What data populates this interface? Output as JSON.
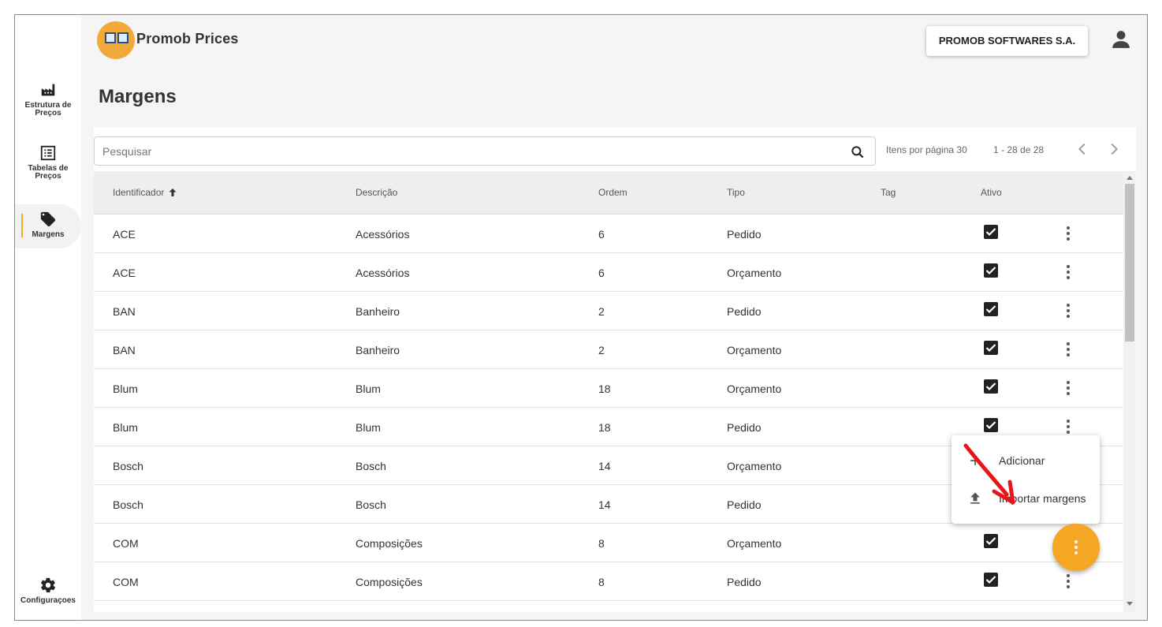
{
  "app": {
    "title": "Promob Prices",
    "company": "PROMOB SOFTWARES S.A."
  },
  "sidebar": {
    "items": [
      {
        "label": "Estrutura de Preços",
        "icon": "factory-icon"
      },
      {
        "label": "Tabelas de Preços",
        "icon": "list-icon"
      },
      {
        "label": "Margens",
        "icon": "tag-icon",
        "active": true
      }
    ],
    "settings": {
      "label": "Configuraçoes",
      "icon": "gear-icon"
    }
  },
  "page": {
    "title": "Margens"
  },
  "search": {
    "placeholder": "Pesquisar"
  },
  "pager": {
    "items_per_page": "Itens por página 30",
    "range": "1 - 28 de 28"
  },
  "table": {
    "columns": [
      "Identificador",
      "Descrição",
      "Ordem",
      "Tipo",
      "Tag",
      "Ativo"
    ],
    "rows": [
      {
        "id": "ACE",
        "desc": "Acessórios",
        "order": "6",
        "type": "Pedido",
        "tag": "",
        "active": true
      },
      {
        "id": "ACE",
        "desc": "Acessórios",
        "order": "6",
        "type": "Orçamento",
        "tag": "",
        "active": true
      },
      {
        "id": "BAN",
        "desc": "Banheiro",
        "order": "2",
        "type": "Pedido",
        "tag": "",
        "active": true
      },
      {
        "id": "BAN",
        "desc": "Banheiro",
        "order": "2",
        "type": "Orçamento",
        "tag": "",
        "active": true
      },
      {
        "id": "Blum",
        "desc": "Blum",
        "order": "18",
        "type": "Orçamento",
        "tag": "",
        "active": true
      },
      {
        "id": "Blum",
        "desc": "Blum",
        "order": "18",
        "type": "Pedido",
        "tag": "",
        "active": true
      },
      {
        "id": "Bosch",
        "desc": "Bosch",
        "order": "14",
        "type": "Orçamento",
        "tag": "",
        "active": true
      },
      {
        "id": "Bosch",
        "desc": "Bosch",
        "order": "14",
        "type": "Pedido",
        "tag": "",
        "active": true
      },
      {
        "id": "COM",
        "desc": "Composições",
        "order": "8",
        "type": "Orçamento",
        "tag": "",
        "active": true
      },
      {
        "id": "COM",
        "desc": "Composições",
        "order": "8",
        "type": "Pedido",
        "tag": "",
        "active": true
      }
    ]
  },
  "menu": {
    "items": [
      {
        "label": "Adicionar",
        "icon": "plus-icon"
      },
      {
        "label": "Importar margens",
        "icon": "upload-icon"
      }
    ]
  },
  "colors": {
    "accent": "#f5a623",
    "annotation": "#e8141b"
  }
}
